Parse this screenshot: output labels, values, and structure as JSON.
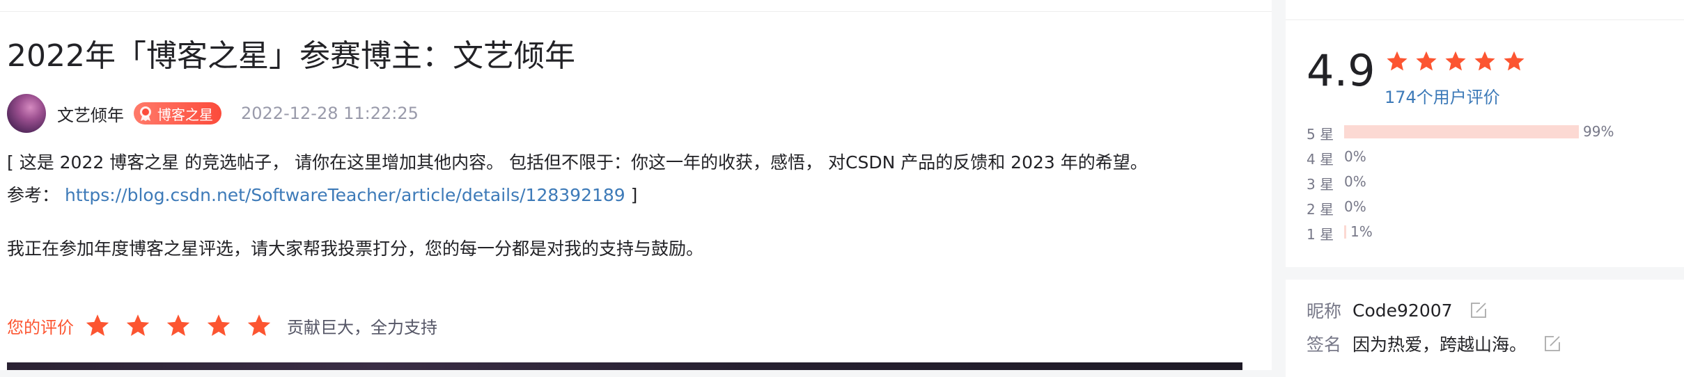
{
  "post": {
    "title": "2022年「博客之星」参赛博主：文艺倾年",
    "author": "文艺倾年",
    "badge": "博客之星",
    "badge_icon": "award-icon",
    "date": "2022-12-28 11:22:25",
    "paragraph1": "[ 这是 2022 博客之星 的竞选帖子， 请你在这里增加其他内容。 包括但不限于：你这一年的收获，感悟， 对CSDN 产品的反馈和 2023 年的希望。",
    "ref_prefix": "参考：",
    "ref_link": "https://blog.csdn.net/SoftwareTeacher/article/details/128392189",
    "ref_suffix": " ]",
    "paragraph2": "我正在参加年度博客之星评选，请大家帮我投票打分，您的每一分都是对我的支持与鼓励。"
  },
  "my_rating": {
    "label": "您的评价",
    "stars": 5,
    "comment": "贡献巨大，全力支持"
  },
  "summary": {
    "score": "4.9",
    "stars": 5,
    "user_count": "174个用户评价",
    "distribution": [
      {
        "label": "5 星",
        "percent": "99%",
        "fraction": 0.99
      },
      {
        "label": "4 星",
        "percent": "0%",
        "fraction": 0
      },
      {
        "label": "3 星",
        "percent": "0%",
        "fraction": 0
      },
      {
        "label": "2 星",
        "percent": "0%",
        "fraction": 0
      },
      {
        "label": "1 星",
        "percent": "1%",
        "fraction": 0.01
      }
    ]
  },
  "profile": {
    "nickname_label": "昵称",
    "nickname": "Code92007",
    "signature_label": "签名",
    "signature": "因为热爱，跨越山海。"
  },
  "colors": {
    "accent": "#fc5531",
    "link": "#3d7ab8",
    "bar": "#fcd9d3",
    "badge": "#fc4b3b"
  }
}
